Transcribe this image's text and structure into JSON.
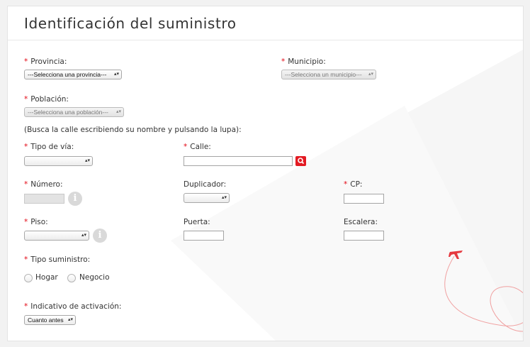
{
  "title": "Identificación del suministro",
  "required_mark": "*",
  "provincia": {
    "label": "Provincia:",
    "value": "---Selecciona una provincia---"
  },
  "municipio": {
    "label": "Municipio:",
    "value": "---Selecciona un municipio---"
  },
  "poblacion": {
    "label": "Población:",
    "value": "---Selecciona una población---"
  },
  "hint": "(Busca la calle escribiendo su nombre y pulsando la lupa):",
  "tipo_via": {
    "label": "Tipo de vía:",
    "value": ""
  },
  "calle": {
    "label": "Calle:",
    "value": ""
  },
  "numero": {
    "label": "Número:",
    "value": ""
  },
  "duplicador": {
    "label": "Duplicador:",
    "value": ""
  },
  "cp": {
    "label": "CP:",
    "value": ""
  },
  "piso": {
    "label": "Piso:",
    "value": ""
  },
  "puerta": {
    "label": "Puerta:",
    "value": ""
  },
  "escalera": {
    "label": "Escalera:",
    "value": ""
  },
  "tipo_suministro": {
    "label": "Tipo suministro:",
    "options": [
      "Hogar",
      "Negocio"
    ]
  },
  "activacion": {
    "label": "Indicativo de activación:",
    "value": "Cuanto antes"
  },
  "info_symbol": "i",
  "select_arrows": "▴▾",
  "colors": {
    "accent": "#e31b23",
    "required": "#e30613",
    "text": "#333333"
  }
}
